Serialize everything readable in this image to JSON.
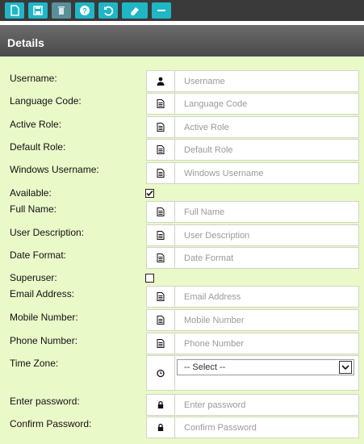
{
  "panel": {
    "title": "Details"
  },
  "form": {
    "username": {
      "label": "Username:",
      "placeholder": "Username",
      "icon": "user-icon"
    },
    "language_code": {
      "label": "Language Code:",
      "placeholder": "Language Code",
      "icon": "document-icon"
    },
    "active_role": {
      "label": "Active Role:",
      "placeholder": "Active Role",
      "icon": "document-icon"
    },
    "default_role": {
      "label": "Default Role:",
      "placeholder": "Default Role",
      "icon": "document-icon"
    },
    "windows_username": {
      "label": "Windows Username:",
      "placeholder": "Windows Username",
      "icon": "document-icon"
    },
    "available": {
      "label": "Available:",
      "checked": true
    },
    "full_name": {
      "label": "Full Name:",
      "placeholder": "Full Name",
      "icon": "document-icon"
    },
    "user_description": {
      "label": "User Description:",
      "placeholder": "User Description",
      "icon": "document-icon"
    },
    "date_format": {
      "label": "Date Format:",
      "placeholder": "Date Format",
      "icon": "document-icon"
    },
    "superuser": {
      "label": "Superuser:",
      "checked": false
    },
    "email_address": {
      "label": "Email Address:",
      "placeholder": "Email Address",
      "icon": "document-icon"
    },
    "mobile_number": {
      "label": "Mobile Number:",
      "placeholder": "Mobile Number",
      "icon": "document-icon"
    },
    "phone_number": {
      "label": "Phone Number:",
      "placeholder": "Phone Number",
      "icon": "document-icon"
    },
    "time_zone": {
      "label": "Time Zone:",
      "selected": "-- Select --",
      "icon": "clock-icon"
    },
    "enter_password": {
      "label": "Enter password:",
      "placeholder": "Enter password",
      "icon": "lock-icon"
    },
    "confirm_password": {
      "label": "Confirm Password:",
      "placeholder": "Confirm Password",
      "icon": "lock-icon"
    }
  },
  "toolbar": {
    "icons": [
      "new-document-icon",
      "save-icon",
      "trash-icon",
      "help-icon",
      "undo-icon",
      "eraser-icon",
      "minus-icon"
    ]
  },
  "colors": {
    "toolbar_button": "#1fb6c6",
    "toolbar_button_disabled": "#5a8f99",
    "form_background": "#eaf9c8",
    "header": "#555555"
  }
}
